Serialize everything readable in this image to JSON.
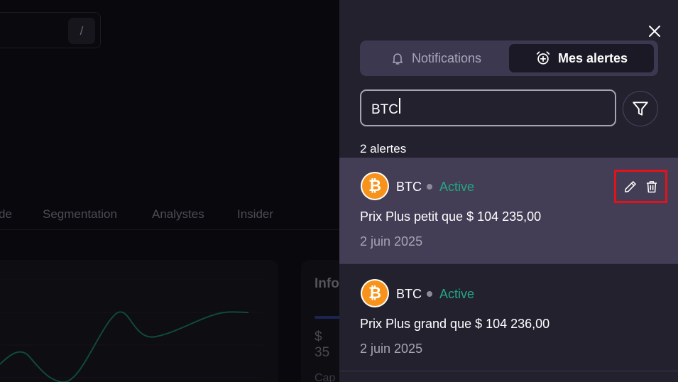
{
  "background": {
    "search_shortcut": "/",
    "tabs": [
      "de",
      "Segmentation",
      "Analystes",
      "Insider"
    ],
    "info_card": {
      "title": "Info",
      "value": "$ 35",
      "sub": "Cap"
    }
  },
  "drawer": {
    "close_icon": "close-icon",
    "tabs": [
      {
        "label": "Notifications",
        "icon": "bell-icon",
        "active": false
      },
      {
        "label": "Mes alertes",
        "icon": "alarm-clock-plus-icon",
        "active": true
      }
    ],
    "search": {
      "value": "BTC",
      "placeholder": ""
    },
    "filter_icon": "filter-icon",
    "count_label": "2 alertes",
    "alerts": [
      {
        "symbol": "BTC",
        "status": "Active",
        "condition": "Prix Plus petit que $ 104 235,00",
        "date": "2 juin 2025",
        "selected": true
      },
      {
        "symbol": "BTC",
        "status": "Active",
        "condition": "Prix Plus grand que $ 104 236,00",
        "date": "2 juin 2025",
        "selected": false
      }
    ]
  },
  "colors": {
    "drawer_bg": "#24212f",
    "selected_row": "#433e55",
    "active_status": "#22a882",
    "bitcoin_orange": "#f7931a",
    "highlight_border": "#e0131b",
    "chart_line": "#0f4a3a"
  }
}
